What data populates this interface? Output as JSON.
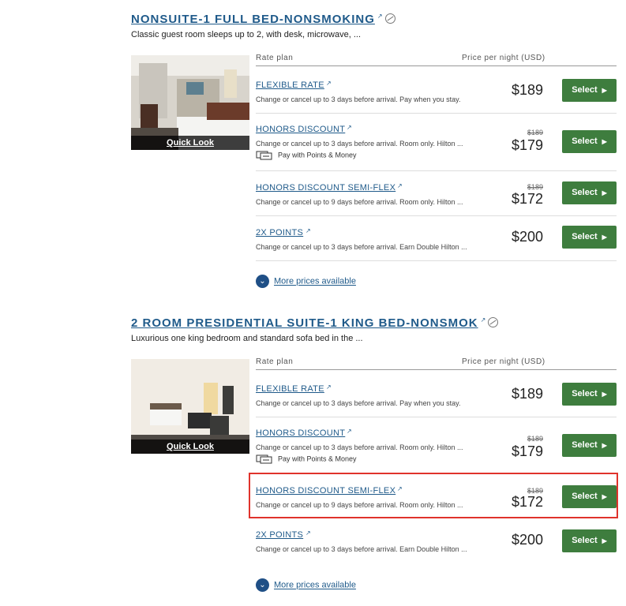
{
  "rooms": [
    {
      "title": "NONSUITE-1 FULL BED-NONSMOKING",
      "description": "Classic guest room sleeps up to 2, with desk, microwave, ...",
      "quick_look": "Quick Look",
      "rate_plan_header": "Rate plan",
      "price_header": "Price per night (USD)",
      "more_prices": "More prices available",
      "rates": [
        {
          "name": "FLEXIBLE RATE",
          "description": "Change or cancel up to 3 days before arrival. Pay when you stay.",
          "original_price": "",
          "price": "$189",
          "points_money": "",
          "select": "Select"
        },
        {
          "name": "HONORS DISCOUNT",
          "description": "Change or cancel up to 3 days before arrival. Room only. Hilton ...",
          "original_price": "$189",
          "price": "$179",
          "points_money": "Pay with Points & Money",
          "select": "Select"
        },
        {
          "name": "HONORS DISCOUNT SEMI-FLEX",
          "description": "Change or cancel up to 9 days before arrival. Room only. Hilton ...",
          "original_price": "$189",
          "price": "$172",
          "points_money": "",
          "select": "Select"
        },
        {
          "name": "2X POINTS",
          "description": "Change or cancel up to 3 days before arrival. Earn Double Hilton ...",
          "original_price": "",
          "price": "$200",
          "points_money": "",
          "select": "Select"
        }
      ]
    },
    {
      "title": "2 ROOM PRESIDENTIAL SUITE-1 KING BED-NONSMOK",
      "description": "Luxurious one king bedroom and standard sofa bed in the ...",
      "quick_look": "Quick Look",
      "rate_plan_header": "Rate plan",
      "price_header": "Price per night (USD)",
      "more_prices": "More prices available",
      "rates": [
        {
          "name": "FLEXIBLE RATE",
          "description": "Change or cancel up to 3 days before arrival. Pay when you stay.",
          "original_price": "",
          "price": "$189",
          "points_money": "",
          "select": "Select"
        },
        {
          "name": "HONORS DISCOUNT",
          "description": "Change or cancel up to 3 days before arrival. Room only. Hilton ...",
          "original_price": "$189",
          "price": "$179",
          "points_money": "Pay with Points & Money",
          "select": "Select"
        },
        {
          "name": "HONORS DISCOUNT SEMI-FLEX",
          "description": "Change or cancel up to 9 days before arrival. Room only. Hilton ...",
          "original_price": "$189",
          "price": "$172",
          "points_money": "",
          "select": "Select"
        },
        {
          "name": "2X POINTS",
          "description": "Change or cancel up to 3 days before arrival. Earn Double Hilton ...",
          "original_price": "",
          "price": "$200",
          "points_money": "",
          "select": "Select"
        }
      ]
    }
  ],
  "colors": {
    "link": "#1f5a8a",
    "select_button": "#3e7d3e",
    "highlight": "#e0332c"
  },
  "icons": [
    "external-link-icon",
    "no-smoking-icon",
    "chevron-down-icon",
    "points-money-icon",
    "caret-right-icon"
  ]
}
